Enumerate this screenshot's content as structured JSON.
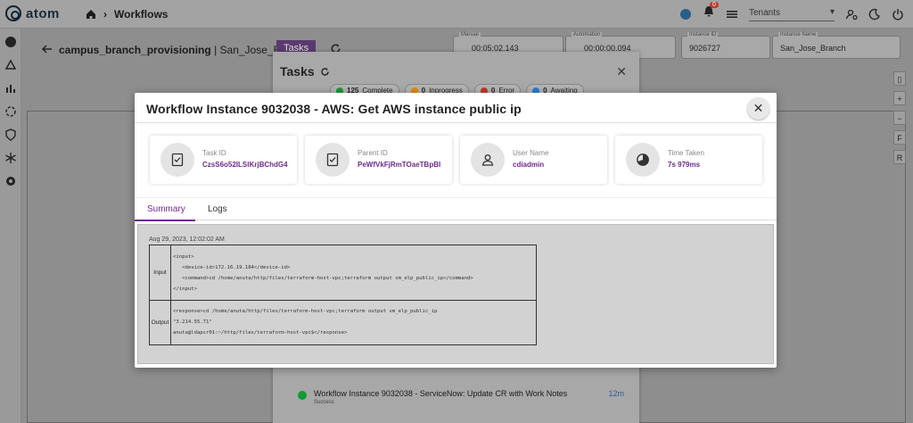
{
  "app": {
    "logo_text": "atom",
    "breadcrumb": "Workflows",
    "tenant_placeholder": "Tenants",
    "notification_count": "0"
  },
  "workflow": {
    "name": "campus_branch_provisioning",
    "separator": "|",
    "instance": "San_Jose_Branch",
    "tasks_button": "Tasks",
    "fields": [
      {
        "label": "Manual",
        "value": "00:05:02.143"
      },
      {
        "label": "Automation",
        "value": "00:00:00.094"
      },
      {
        "label": "Instance ID",
        "value": "9026727"
      },
      {
        "label": "Instance Name",
        "value": "San_Jose_Branch"
      }
    ],
    "right_tools": [
      "+",
      "−",
      "F",
      "R"
    ]
  },
  "tasks_panel": {
    "title": "Tasks",
    "pills": [
      {
        "count": "125",
        "label": "Complete",
        "color": "#1a9a3a"
      },
      {
        "count": "0",
        "label": "Inprogress",
        "color": "#e08a00"
      },
      {
        "count": "0",
        "label": "Error",
        "color": "#c0392b"
      },
      {
        "count": "0",
        "label": "Awaiting",
        "color": "#2a7bd0"
      }
    ],
    "item": {
      "title": "Workflow Instance 9032038 - ServiceNow: Update CR with Work Notes",
      "status": "Success",
      "time": "12m"
    }
  },
  "modal": {
    "title": "Workflow Instance 9032038 - AWS: Get AWS instance public ip",
    "cards": [
      {
        "label": "Task ID",
        "value": "CzsS6o52ILSlKrjBChdG4",
        "icon": "task-check-icon"
      },
      {
        "label": "Parent ID",
        "value": "PeWfVkFjRmTOaeTBpBI",
        "icon": "task-check-icon"
      },
      {
        "label": "User Name",
        "value": "cdiadmin",
        "icon": "user-icon"
      },
      {
        "label": "Time Taken",
        "value": "7s 979ms",
        "icon": "timer-icon"
      }
    ],
    "tabs": [
      "Summary",
      "Logs"
    ],
    "summary": {
      "date": "Aug 29, 2023, 12:02:02 AM",
      "input_label": "Input",
      "input_text": "<input>\n   <device-id>172.16.19.184</device-id>\n   <command>cd /home/anuta/http/files/terraform-host-vpc;terraform output vm_elp_public_ip</command>\n</input>",
      "output_label": "Output",
      "output_text": "<response>cd /home/anuta/http/files/terraform-host-vpc;terraform output vm_elp_public_ip\n\"3.214.55.71\"\nanuta@ldapsr01:~/http/files/terraform-host-vpc$</response>"
    }
  }
}
